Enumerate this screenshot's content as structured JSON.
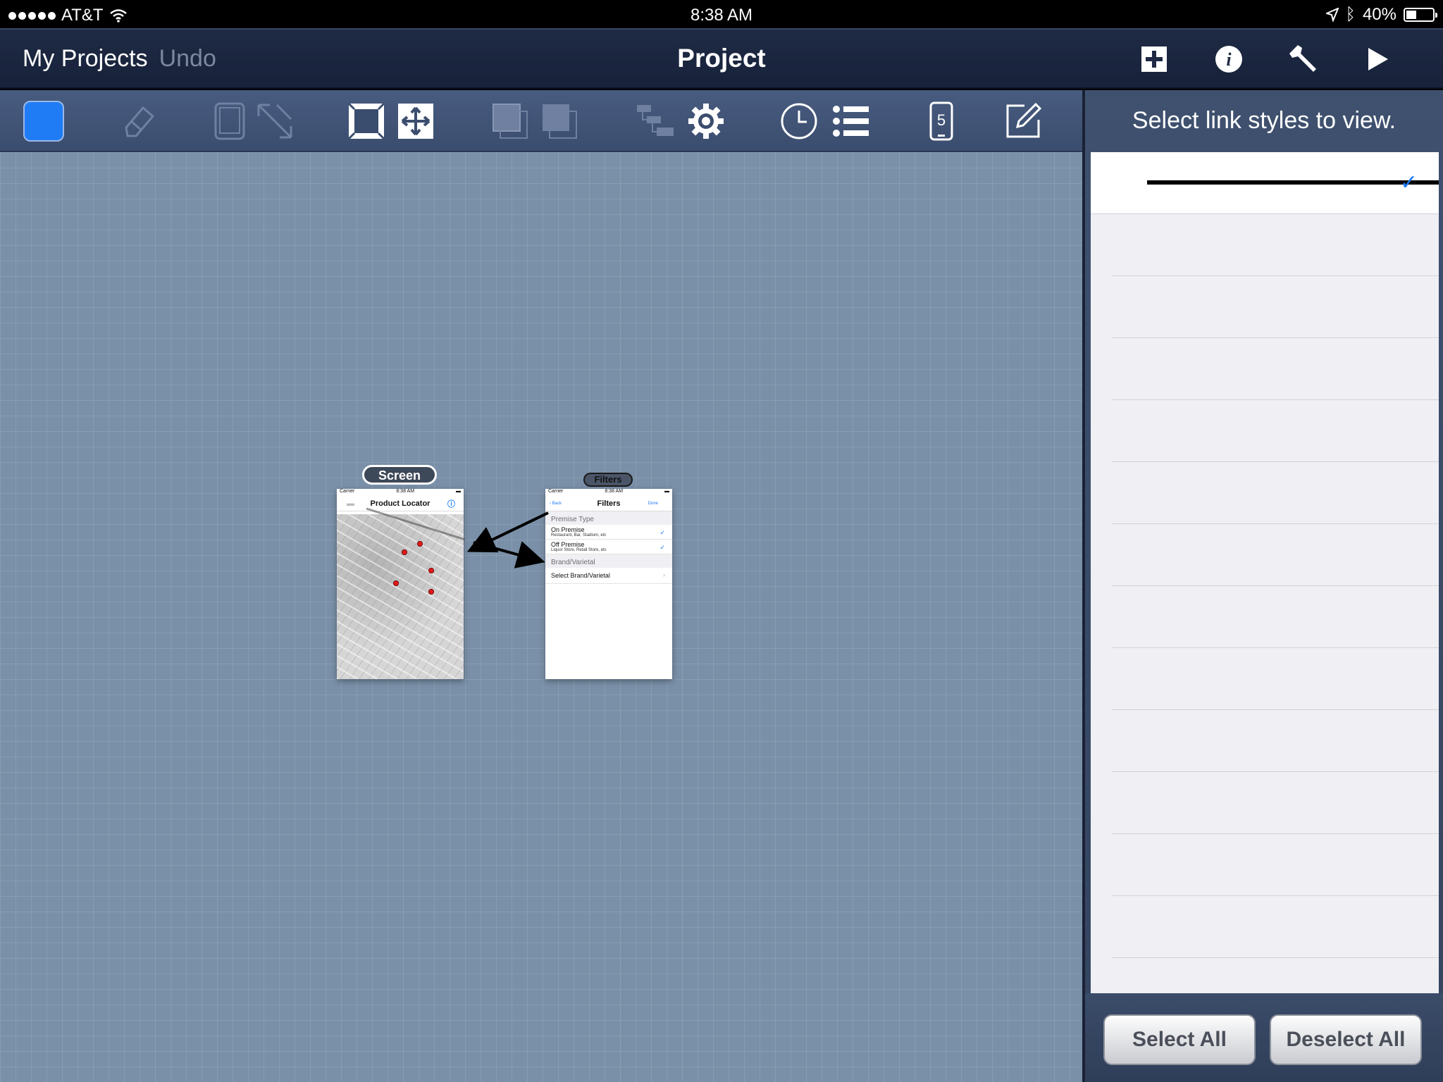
{
  "status_bar": {
    "carrier": "AT&T",
    "time": "8:38 AM",
    "battery": "40%",
    "battery_level": 0.4
  },
  "nav": {
    "back_label": "My Projects",
    "undo_label": "Undo",
    "title": "Project",
    "icons": [
      "add-icon",
      "info-icon",
      "wrench-icon",
      "play-icon"
    ]
  },
  "toolbar": {
    "icons": [
      "color-swatch-icon",
      "eraser-icon",
      "device-icon",
      "resize-diagonal-icon",
      "fit-screen-icon",
      "move-icon",
      "bring-front-icon",
      "send-back-icon",
      "hierarchy-icon",
      "gear-icon",
      "clock-icon",
      "list-icon",
      "phone-count-icon",
      "edit-icon"
    ],
    "phone_count": "5",
    "accent": "#1f7cf5"
  },
  "canvas": {
    "screens": [
      {
        "label": "Screen",
        "status_carrier": "Carrier",
        "status_time": "8:38 AM",
        "title": "Product Locator"
      },
      {
        "label": "Filters",
        "status_carrier": "Carrier",
        "status_time": "8:38 AM",
        "back": "Back",
        "title": "Filters",
        "done": "Done",
        "section1": "Premise Type",
        "rows": [
          {
            "title": "On Premise",
            "subtitle": "Restaurant, Bar, Stadium, etc"
          },
          {
            "title": "Off Premise",
            "subtitle": "Liquor Store, Retail Store, etc"
          }
        ],
        "section2": "Brand/Varietal",
        "brand_row": "Select Brand/Varietal"
      }
    ]
  },
  "panel": {
    "title": "Select link styles to view.",
    "select_all": "Select All",
    "deselect_all": "Deselect All"
  }
}
